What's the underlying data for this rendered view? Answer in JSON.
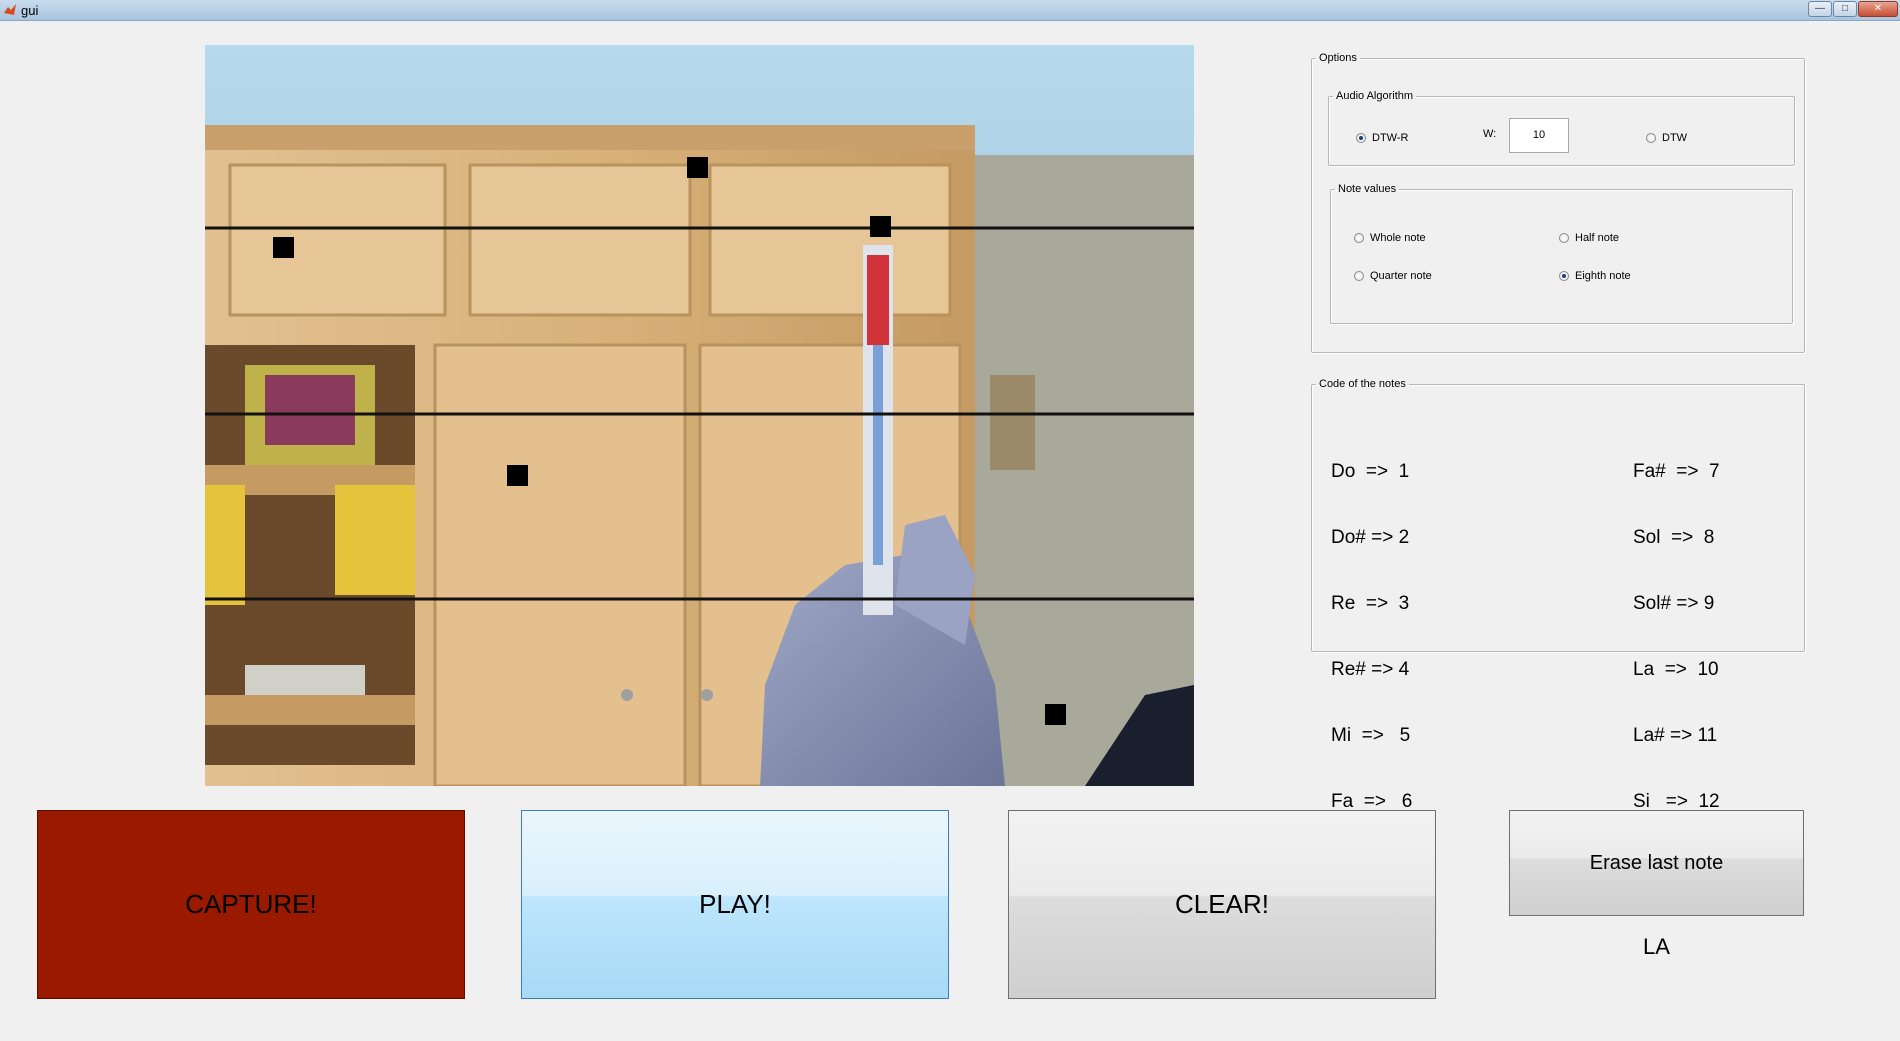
{
  "window": {
    "title": "gui"
  },
  "options": {
    "title": "Options",
    "audio_algorithm": {
      "title": "Audio Algorithm",
      "options": [
        {
          "label": "DTW-R",
          "checked": true
        },
        {
          "label": "DTW",
          "checked": false
        }
      ],
      "w_label": "W:",
      "w_value": "10"
    },
    "note_values": {
      "title": "Note values",
      "options": [
        {
          "label": "Whole note",
          "checked": false
        },
        {
          "label": "Half note",
          "checked": false
        },
        {
          "label": "Quarter note",
          "checked": false
        },
        {
          "label": "Eighth note",
          "checked": true
        }
      ]
    }
  },
  "codes": {
    "title": "Code of the notes",
    "left": [
      "Do  =>  1",
      "Do# => 2",
      "Re  =>  3",
      "Re# => 4",
      "Mi  =>   5",
      "Fa  =>   6"
    ],
    "right": [
      "Fa#  =>  7",
      "Sol  =>  8",
      "Sol# => 9",
      "La  =>  10",
      "La# => 11",
      "Si   =>  12"
    ]
  },
  "buttons": {
    "capture": "CAPTURE!",
    "play": "PLAY!",
    "clear": "CLEAR!",
    "erase": "Erase last note"
  },
  "last_note": "LA",
  "colors": {
    "capture_bg": "#9a1a00",
    "play_bg": "#bee6fd",
    "marker": "#000000"
  }
}
